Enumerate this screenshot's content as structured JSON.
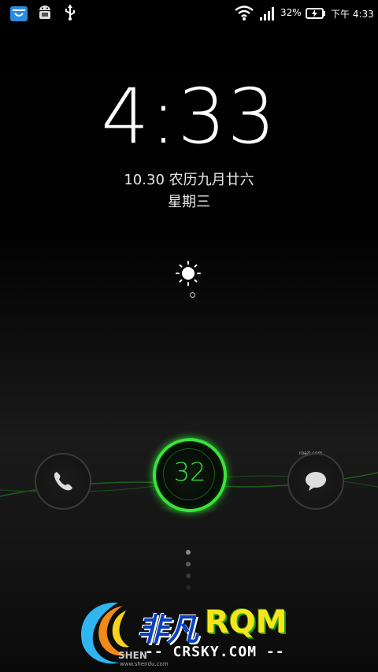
{
  "status_bar": {
    "battery_percent": "32%",
    "time": "下午 4:33",
    "icons": [
      "store-icon",
      "android-debug-icon",
      "usb-icon",
      "wifi-icon",
      "signal-icon",
      "battery-charging-icon"
    ]
  },
  "lockscreen": {
    "clock": "4:33",
    "date": "10.30 农历九月廿六",
    "weekday": "星期三",
    "weather_icon": "sun-icon",
    "unlock_number": "32",
    "left_shortcut_icon": "phone-icon",
    "right_shortcut_icon": "message-icon",
    "right_shortcut_small_label": "roazi.com",
    "page_indicator_count": 4
  },
  "watermark": {
    "chinese": "非凡",
    "rom": "RQM",
    "site": "-- CRSKY.COM --",
    "brand": "SHEN",
    "brand_site": "www.shendu.com"
  },
  "colors": {
    "accent_green": "#39e33a",
    "background": "#000000"
  }
}
